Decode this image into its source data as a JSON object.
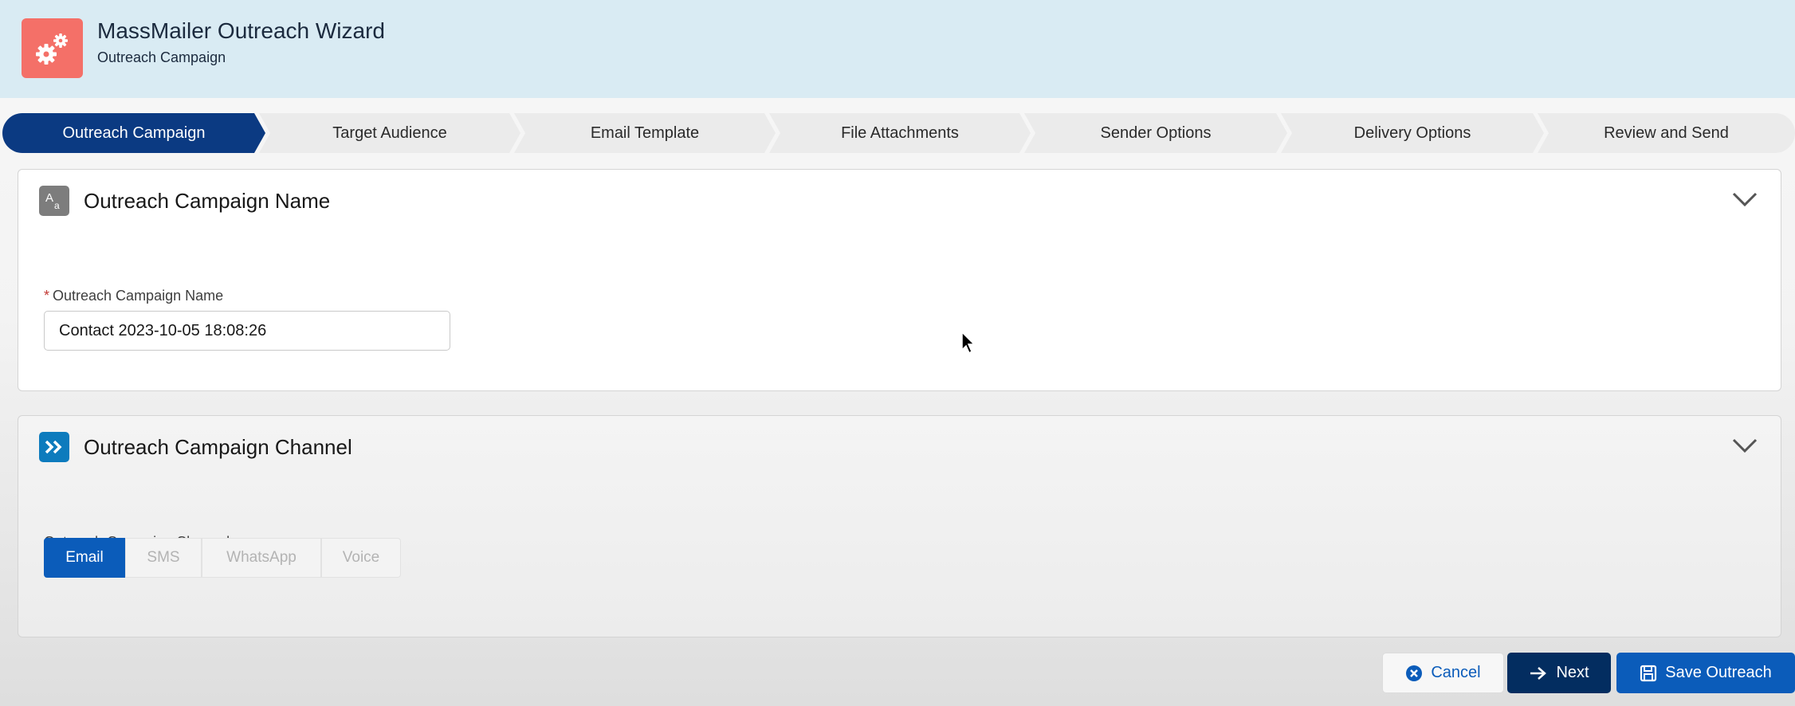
{
  "header": {
    "app_icon": "gears-icon",
    "title": "MassMailer Outreach Wizard",
    "subtitle": "Outreach Campaign"
  },
  "path": {
    "steps": [
      {
        "label": "Outreach Campaign",
        "active": true
      },
      {
        "label": "Target Audience",
        "active": false
      },
      {
        "label": "Email Template",
        "active": false
      },
      {
        "label": "File Attachments",
        "active": false
      },
      {
        "label": "Sender Options",
        "active": false
      },
      {
        "label": "Delivery Options",
        "active": false
      },
      {
        "label": "Review and Send",
        "active": false
      }
    ]
  },
  "section_name": {
    "icon": "text-aa-icon",
    "title": "Outreach Campaign Name",
    "field_label": "Outreach Campaign Name",
    "required_mark": "*",
    "field_value": "Contact 2023-10-05 18:08:26"
  },
  "section_channel": {
    "icon": "double-chevron-right-icon",
    "title": "Outreach Campaign Channel",
    "field_label": "Outreach Campaign Channel",
    "options": [
      {
        "label": "Email",
        "selected": true
      },
      {
        "label": "SMS",
        "selected": false
      },
      {
        "label": "WhatsApp",
        "selected": false
      },
      {
        "label": "Voice",
        "selected": false
      }
    ]
  },
  "footer": {
    "cancel_label": "Cancel",
    "next_label": "Next",
    "save_label": "Save Outreach"
  },
  "colors": {
    "header_bg": "#d9ebf3",
    "app_icon_bg": "#f47068",
    "path_active": "#0b3a82",
    "brand_blue": "#0b5cba",
    "next_button": "#032d60"
  }
}
